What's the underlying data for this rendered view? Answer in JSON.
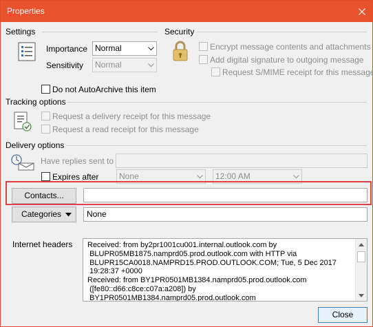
{
  "window": {
    "title": "Properties"
  },
  "settings": {
    "group_label": "Settings",
    "importance_label": "Importance",
    "importance_value": "Normal",
    "sensitivity_label": "Sensitivity",
    "sensitivity_value": "Normal",
    "autoarchive_label": "Do not AutoArchive this item"
  },
  "security": {
    "group_label": "Security",
    "encrypt_label": "Encrypt message contents and attachments",
    "signature_label": "Add digital signature to outgoing message",
    "smime_label": "Request S/MIME receipt for this message"
  },
  "tracking": {
    "group_label": "Tracking options",
    "delivery_receipt_label": "Request a delivery receipt for this message",
    "read_receipt_label": "Request a read receipt for this message"
  },
  "delivery": {
    "group_label": "Delivery options",
    "replies_label": "Have replies sent to",
    "replies_value": "",
    "expires_label": "Expires after",
    "expires_date": "None",
    "expires_time": "12:00 AM"
  },
  "contacts": {
    "button_label": "Contacts...",
    "value": ""
  },
  "categories": {
    "button_label": "Categories",
    "value": "None"
  },
  "headers": {
    "label": "Internet headers",
    "text": "Received: from by2pr1001cu001.internal.outlook.com by\n BLUPR05MB1875.namprd05.prod.outlook.com with HTTP via\n BLUPR15CA0018.NAMPRD15.PROD.OUTLOOK.COM; Tue, 5 Dec 2017\n 19:28:37 +0000\nReceived: from BY1PR0501MB1384.namprd05.prod.outlook.com\n ([fe80::d66:c8ce:c07a:a208]) by\n BY1PR0501MB1384.namprd05.prod.outlook.com"
  },
  "close_button": {
    "label": "Close"
  },
  "colors": {
    "titlebar": "#e8522d",
    "highlight": "#e0404a",
    "dialog_bg": "#f0f0f0"
  }
}
